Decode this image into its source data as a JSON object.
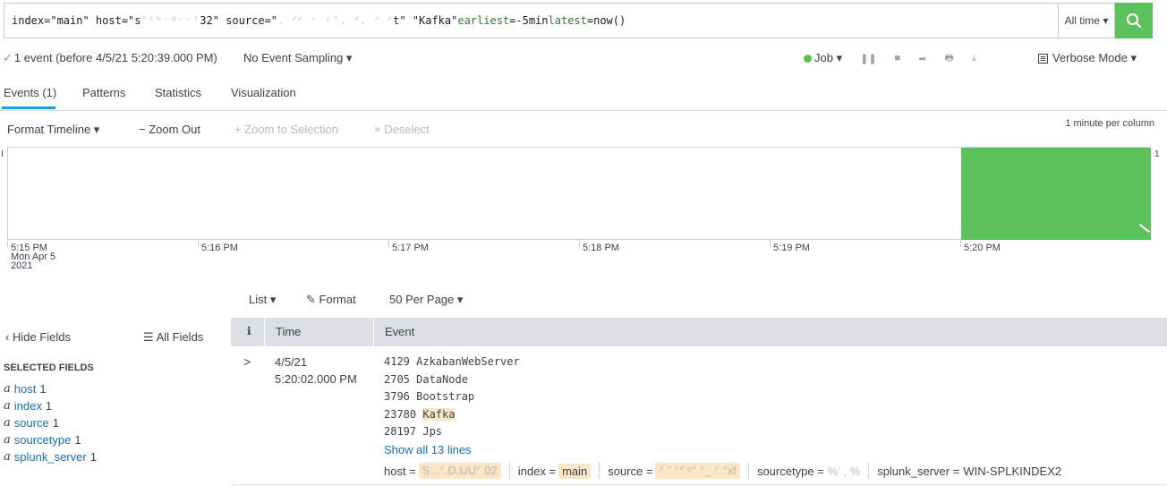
{
  "search": {
    "query_parts": {
      "p1": "index=\"main\" host=\"s",
      "p1_blur": "'ᵗʰ⁻ᵈ⁻⁻' ",
      "p2": "32\" source=\"",
      "p2_blur": ". ᐟᐟ ᶜ ᶜ'.   ᐟ. ᐟ ᐟ ",
      "p3": "t\" \"Kafka\" ",
      "kw_earliest": "earliest",
      "p4": "=-5min ",
      "kw_latest": "latest",
      "p5": "=now()"
    },
    "time_range": "All time ▾",
    "search_icon": "search-icon",
    "accent_color": "#5cc05c"
  },
  "status": {
    "check": "✓",
    "event_count": "1 event (before 4/5/21 5:20:39.000 PM)",
    "sampling": "No Event Sampling ▾",
    "job": "Job ▾",
    "mode": "Verbose Mode ▾"
  },
  "tabs": {
    "events": "Events (1)",
    "patterns": "Patterns",
    "statistics": "Statistics",
    "visualization": "Visualization"
  },
  "timeline_toolbar": {
    "format_timeline": "Format Timeline ▾",
    "zoom_out": "− Zoom Out",
    "zoom_selection": "+ Zoom to Selection",
    "deselect": "× Deselect",
    "per_column": "1 minute per column"
  },
  "chart_data": {
    "type": "bar",
    "categories": [
      "5:15 PM",
      "5:16 PM",
      "5:17 PM",
      "5:18 PM",
      "5:19 PM",
      "5:20 PM"
    ],
    "values": [
      0,
      0,
      0,
      0,
      0,
      1
    ],
    "ylim": [
      0,
      1
    ],
    "y_max_label": "1",
    "first_label_sub1": "Mon Apr 5",
    "first_label_sub2": "2021",
    "bar_color": "#5cc05c"
  },
  "results_toolbar": {
    "list": "List ▾",
    "format": "Format",
    "per_page": "50 Per Page ▾"
  },
  "sidebar": {
    "hide_fields": "Hide Fields",
    "all_fields": "All Fields",
    "heading": "SELECTED FIELDS",
    "fields": [
      {
        "type": "a",
        "name": "host",
        "count": "1"
      },
      {
        "type": "a",
        "name": "index",
        "count": "1"
      },
      {
        "type": "a",
        "name": "source",
        "count": "1"
      },
      {
        "type": "a",
        "name": "sourcetype",
        "count": "1"
      },
      {
        "type": "a",
        "name": "splunk_server",
        "count": "1"
      }
    ]
  },
  "table": {
    "col_info": "i",
    "col_time": "Time",
    "col_event": "Event",
    "row": {
      "expander": ">",
      "date": "4/5/21",
      "time": "5:20:02.000 PM",
      "lines": {
        "l1": "4129 AzkabanWebServer",
        "l2": "2705 DataNode",
        "l3": "3796 Bootstrap",
        "l4_pre": "23780 ",
        "l4_hl": "Kafka",
        "l5": "28197 Jps"
      },
      "show_all": "Show all 13 lines",
      "fields": {
        "host_key": "host =",
        "host_val": "S...ᐟ.D.UUᐟ 02",
        "index_key": "index =",
        "index_val": "main",
        "source_key": "source =",
        "source_val": "ᐟ ˜ ᐟᐟ ᶜᐟ ᐟ_ ᐟ ᐟxt",
        "sourcetype_key": "sourcetype =",
        "sourcetype_val": "%' , %",
        "server_key": "splunk_server =",
        "server_val": "WIN-SPLKINDEX2"
      }
    }
  }
}
